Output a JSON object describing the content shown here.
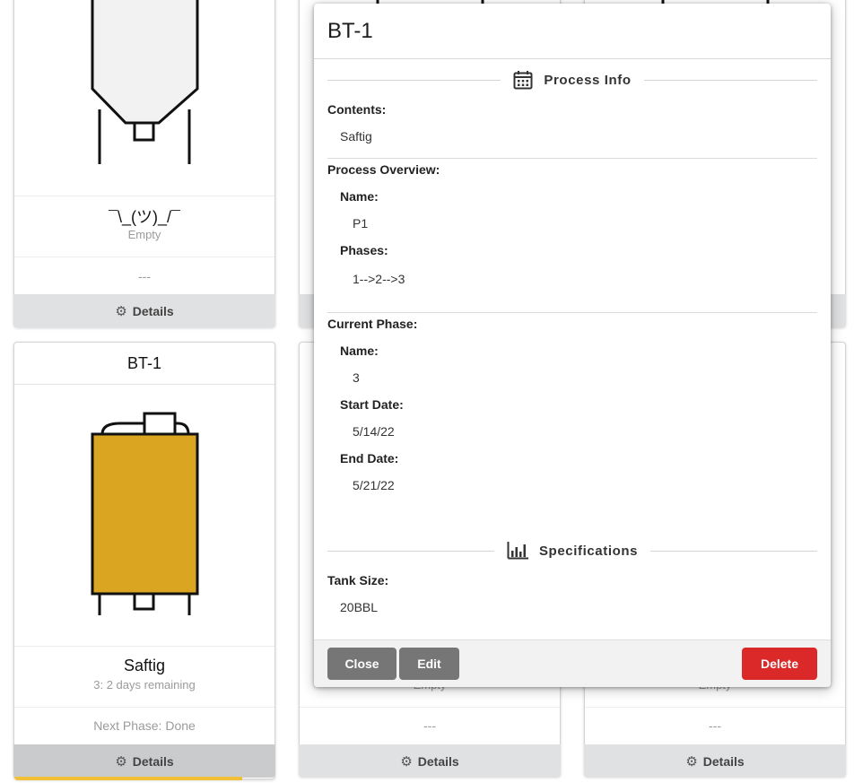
{
  "cards": {
    "top_left": {
      "title": "¯\\_(ツ)_/¯",
      "status": "Empty",
      "next_phase": "---",
      "details_label": "Details"
    },
    "bottom_left": {
      "header": "BT-1",
      "title": "Saftig",
      "status": "3: 2 days remaining",
      "next_phase": "Next Phase: Done",
      "details_label": "Details",
      "progress": 0.87,
      "fill_color": "#daa520"
    },
    "bottom_middle": {
      "status": "Empty",
      "next_phase": "---",
      "details_label": "Details"
    },
    "bottom_right": {
      "status": "Empty",
      "next_phase": "---",
      "details_label": "Details"
    }
  },
  "modal": {
    "title": "BT-1",
    "process_info_heading": "Process Info",
    "process_info_icon": "calendar-icon",
    "contents_label": "Contents:",
    "contents_value": "Saftig",
    "overview_label": "Process Overview:",
    "overview_name_label": "Name:",
    "overview_name_value": "P1",
    "phases_label": "Phases:",
    "phases_value": "1-->2-->3",
    "current_phase_label": "Current Phase:",
    "current_name_label": "Name:",
    "current_name_value": "3",
    "start_date_label": "Start Date:",
    "start_date_value": "5/14/22",
    "end_date_label": "End Date:",
    "end_date_value": "5/21/22",
    "specifications_heading": "Specifications",
    "specifications_icon": "bar-chart-icon",
    "tank_size_label": "Tank Size:",
    "tank_size_value": "20BBL",
    "close_label": "Close",
    "edit_label": "Edit",
    "delete_label": "Delete"
  },
  "colors": {
    "tank_fill": "#daa520",
    "progress": "#f2c037",
    "delete": "#db2828",
    "grey_button": "#767676"
  }
}
